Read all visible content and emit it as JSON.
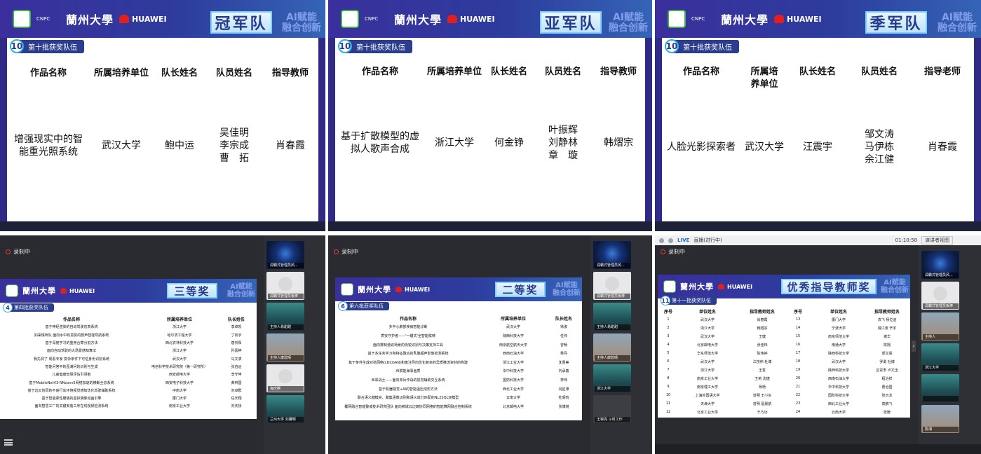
{
  "logos": {
    "cnpc": "CNPC",
    "lzu": "蘭州大學",
    "huawei": "HUAWEI"
  },
  "slogan": {
    "line1": "AI赋能",
    "line2": "融合创新"
  },
  "top_panels": [
    {
      "award": "冠军队",
      "batch_num": "10",
      "batch_label": "第十批获奖队伍",
      "headers": [
        "作品名称",
        "所属培养单位",
        "队长姓名",
        "队员姓名",
        "指导教师"
      ],
      "row": [
        "增强现实中的智能重光照系统",
        "武汉大学",
        "鲍中运",
        "吴佳明 李宗成 曹　拓",
        "肖春霞"
      ]
    },
    {
      "award": "亚军队",
      "batch_num": "10",
      "batch_label": "第十批获奖队伍",
      "headers": [
        "作品名称",
        "所属培养单位",
        "队长姓名",
        "队员姓名",
        "指导教师"
      ],
      "row": [
        "基于扩散模型的虚拟人歌声合成",
        "浙江大学",
        "何金铮",
        "叶振辉 刘静林 章　璇",
        "韩熠宗"
      ]
    },
    {
      "award": "季军队",
      "batch_num": "10",
      "batch_label": "第十批获奖队伍",
      "headers": [
        "作品名称",
        "所属培养单位",
        "队长姓名",
        "队员姓名",
        "指导老师"
      ],
      "row": [
        "人脸光影探索者",
        "武汉大学",
        "汪震宇",
        "邹文涛 马伊栋 余江健",
        "肖春霞"
      ]
    }
  ],
  "bottom_panels": [
    {
      "recording": "录制中",
      "award": "三等奖",
      "batch_num": "4",
      "batch_label": "第四批获奖队伍",
      "headers": [
        "作品名称",
        "所属培养单位",
        "队长姓名"
      ],
      "rows": [
        [
          "基于神经渲染的自动驾驶仿真系统",
          "浙江大学",
          "李卓凯"
        ],
        [
          "如来慎听队 面向水中有意复的厨声智能导航系统",
          "哈尔滨工程大学",
          "丁有宇"
        ],
        [
          "基于深度学习的重用合算分割方法",
          "西北农林科技大学",
          "唐崇阳"
        ],
        [
          "面向自动驾驶的大场景感知算法",
          "浙江大学",
          "孙嘉婷"
        ],
        [
          "我先洞了 观看专家 复杂条件下可信身份识别系统",
          "武汉大学",
          "马文滨"
        ],
        [
          "智能问答中的歪满问的识别与生成",
          "电信科学技术研究院（第一研究所）",
          "张伯远"
        ],
        [
          "儿童健康智慧评估引领者",
          "西安邮电大学",
          "李守坤"
        ],
        [
          "基于MobileNetV3-NNconv5网络加速的横断全息系统",
          "西安电子科技大学",
          "黄林国"
        ],
        [
          "基于边云协同的不良行车环境视觉感知优化驾驶辅助系统",
          "中南大学",
          "刘卓群"
        ],
        [
          "基于智能柔性服装的虚拟偶像动画引擎",
          "厦门大学",
          "任天翔"
        ],
        [
          "面向智慧工厂的关键安装工序在线视频检测系统",
          "南京工业大学",
          "刘天扬"
        ]
      ],
      "tiles": [
        "润霸式管理员风...",
        "润霸式管理员板棒",
        "主持人易甜甜",
        "主持人康碧晴",
        "海庆腾",
        "兰州大学 刘骥明"
      ]
    },
    {
      "recording": "录制中",
      "award": "二等奖",
      "batch_num": "6",
      "batch_label": "第六批获奖队伍",
      "headers": [
        "作品名称",
        "所属培养单位",
        "队长姓名"
      ],
      "rows": [
        [
          "多中心肺部疾病智能诊断",
          "武汉大学",
          "徐淑"
        ],
        [
          "质安守护者——'一键式'全智能赋椅",
          "陕西科技大学",
          "任帅"
        ],
        [
          "面向雾制谐访场景的低锐识别与决策支持工具",
          "南京航空航天大学",
          "曾畅"
        ],
        [
          "基于多任务学习和特征融合的乳腺超声影像检测系统",
          "西南石油大学",
          "吴丹"
        ],
        [
          "基于条件生成对抗网络(cDCGAN)和蜜注导向优化复杂的异质推流资材的构建",
          "浙江工业大学",
          "沈惠美"
        ],
        [
          "AI赋能海事画质",
          "华中科技大学",
          "刘承鑫"
        ],
        [
          "未来战士——面向单兵作战的视觉辅助交互系统",
          "国防科技大学",
          "李伟"
        ],
        [
          "基于机器视觉+AI的智能温压成形方法",
          "西北工业大学",
          "闫星潭"
        ],
        [
          "联合语义糖模充、聚集函数识别和语义成分匹配的NL2SQL双模型",
          "云南大学",
          "杜昭鸣"
        ],
        [
          "覆网融合智能警戒技术研究团队 面向被城云边端协同网络的智能算网融合控制系统",
          "北京邮电大学",
          "张博锐"
        ]
      ],
      "tiles": [
        "润霸式管理员风...",
        "润霸式管理员板棒",
        "主持人易甜甜",
        "主持人康碧晴",
        "浙江大学",
        "王锦亮 斗时工作"
      ]
    },
    {
      "toolbar": {
        "live": "LIVE",
        "status": "直播(进行中)",
        "time": "01:10:58",
        "button": "演讲者视图"
      },
      "recording": "录制中",
      "award": "优秀指导教师奖",
      "batch_num": "11",
      "batch_label": "第十一批获奖队伍",
      "headers": [
        "序号",
        "单位姓名",
        "指导教师姓名",
        "序号",
        "单位姓名",
        "指导教师姓名"
      ],
      "rows": [
        [
          "1",
          "武汉大学",
          "肖春霞",
          "13",
          "厦门大学",
          "袁飞 杨位迪"
        ],
        [
          "2",
          "浙江大学",
          "韩熠宗",
          "14",
          "宁波大学",
          "钱江波 辛宇"
        ],
        [
          "3",
          "武汉大学",
          "王健",
          "15",
          "南京师范大学",
          "谢华"
        ],
        [
          "4",
          "北京邮电大学",
          "张佳玮",
          "16",
          "南通大学",
          "陈翔"
        ],
        [
          "5",
          "华东师范大学",
          "陈伟婷",
          "17",
          "陕西科技大学",
          "郭文强"
        ],
        [
          "6",
          "武汉大学",
          "江技伟 杜博",
          "18",
          "武汉大学",
          "罗勇 杜博"
        ],
        [
          "7",
          "浙江大学",
          "王哲",
          "19",
          "陕西科技大学",
          "吕青李 卢文玉"
        ],
        [
          "8",
          "南京工业大学",
          "王莉 沈捷",
          "20",
          "西南石油大学",
          "程治祥"
        ],
        [
          "9",
          "南京理工大学",
          "杨杨",
          "21",
          "华中科技大学",
          "曹治国"
        ],
        [
          "10",
          "上海外国语大学",
          "曾明 王小东",
          "22",
          "国防科技大学",
          "张示龙"
        ],
        [
          "11",
          "天津大学",
          "曾明 葛晨航",
          "23",
          "西北工业大学",
          "高鹏飞"
        ],
        [
          "12",
          "北京工业大学",
          "于乃功",
          "24",
          "云南大学",
          "张媛"
        ]
      ],
      "tiles": [
        "润霸式管理员风...",
        "润霸式管理员板棒",
        "主持人",
        "浙江大学",
        "",
        "陈湘"
      ]
    }
  ]
}
